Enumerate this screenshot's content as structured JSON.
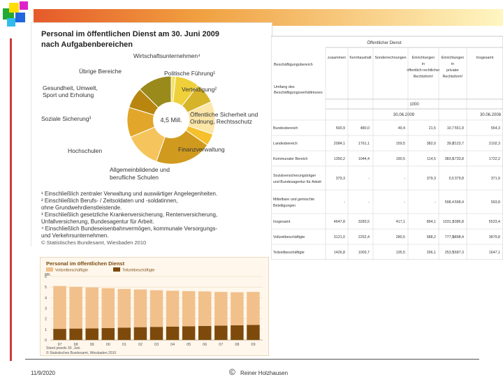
{
  "pie_chart": {
    "title_line1": "Personal im öffentlichen Dienst am 30. Juni 2009",
    "title_line2": "nach Aufgabenbereichen",
    "center_label": "4,5 Mill.",
    "labels": {
      "wirtschaft": "Wirtschaftsunternehmen⁴",
      "uebrige": "Übrige Bereiche",
      "politik": "Politische Führung¹",
      "gesundheit_1": "Gesundheit, Umwelt,",
      "gesundheit_2": "Sport und Erholung",
      "verteidigung": "Verteidigung²",
      "oeffsich_1": "Öffentliche Sicherheit und",
      "oeffsich_2": "Ordnung, Rechtsschutz",
      "sozial": "Soziale Sicherung³",
      "finanz": "Finanzverwaltung",
      "hochschulen": "Hochschulen",
      "allgemein_1": "Allgemeinbildende und",
      "allgemein_2": "berufliche Schulen"
    },
    "footnotes": [
      "¹ Einschließlich zentraler Verwaltung und auswärtiger Angelegenheiten.",
      "² Einschließlich Berufs- / Zeitsoldaten und -soldatinnen,",
      "   ohne Grundwehrdienstleistende.",
      "³ Einschließlich gesetzliche Krankenversicherung, Rentenversicherung,",
      "   Unfallversicherung, Bundesagentur für Arbeit.",
      "⁴ Einschließlich Bundeseisenbahnvermögen, kommunale Versorgungs-",
      "   und Verkehrsunternehmen."
    ],
    "source": "© Statistisches Bundesamt, Wiesbaden 2010"
  },
  "table": {
    "group_header": "Öffentlicher Dienst",
    "row_header_1": "Beschäftigungsbereich",
    "row_header_2": "Umfang des",
    "row_header_3": "Beschäftigungsverhältnisses",
    "columns": [
      "zusammen",
      "Kernhaushalt",
      "Sonderrechnungen",
      "Einrichtungen in öffentlich-rechtlicher Rechtsform¹",
      "Einrichtungen in privater Rechtsform²",
      "Insgesamt"
    ],
    "unit": "1000",
    "date_left": "30.06.2009",
    "date_right": "30.06.2008",
    "rows": [
      {
        "label": "Bundesbereich",
        "values": [
          "500,9",
          "480,0",
          "49,4",
          "21,5",
          "10,7",
          "551,9",
          "554,3"
        ]
      },
      {
        "label": "Landesbereich",
        "values": [
          "2084,1",
          "1761,1",
          "159,5",
          "382,0",
          "39,0",
          "2123,7",
          "2102,3"
        ]
      },
      {
        "label": "Kommunaler Bereich",
        "values": [
          "1350,2",
          "1044,4",
          "190,5",
          "114,5",
          "383,6",
          "1733,8",
          "1722,2"
        ]
      },
      {
        "label": "Sozialversicherungsträger und Bundesagentur für Arbeit",
        "values": [
          "379,3",
          "-",
          "-",
          "379,3",
          "0,5",
          "379,8",
          "371,9"
        ]
      },
      {
        "label": "Mittelbare und gemischte Beteiligungen",
        "values": [
          "-",
          "-",
          "-",
          "-",
          "598,4",
          "598,4",
          "593,8"
        ]
      },
      {
        "label": "Insgesamt",
        "values": [
          "4647,8",
          "3283,5",
          "417,1",
          "894,1",
          "1031,1",
          "5386,8",
          "5523,4"
        ]
      },
      {
        "label": "Vollzeitbeschäftigte",
        "values": [
          "3121,0",
          "2252,4",
          "280,5",
          "588,2",
          "777,5",
          "3898,4",
          "3879,8"
        ]
      },
      {
        "label": "Teilzeitbeschäftigte",
        "values": [
          "1426,8",
          "1003,7",
          "135,5",
          "296,1",
          "253,5",
          "1687,3",
          "1647,1"
        ]
      }
    ]
  },
  "bar_panel": {
    "source": "© Statistisches Bundesamt, Wiesbaden 2010",
    "note": "Stand jeweils 30. Juni."
  },
  "chart_data": [
    {
      "type": "pie",
      "title": "Personal im öffentlichen Dienst am 30. Juni 2009 nach Aufgabenbereichen",
      "total_label": "4,5 Mill.",
      "slices": [
        {
          "label": "Wirtschaftsunternehmen",
          "value": 1.5,
          "color": "#f3e26a"
        },
        {
          "label": "Politische Führung",
          "value": 8,
          "color": "#f0d03a"
        },
        {
          "label": "Verteidigung",
          "value": 7,
          "color": "#d6b42a"
        },
        {
          "label": "Öffentliche Sicherheit und Ordnung, Rechtsschutz",
          "value": 11,
          "color": "#fce6a8"
        },
        {
          "label": "Finanzverwaltung",
          "value": 4,
          "color": "#f5c02c"
        },
        {
          "label": "Allgemeinbildende und berufliche Schulen",
          "value": 19,
          "color": "#d09a1e"
        },
        {
          "label": "Hochschulen",
          "value": 12,
          "color": "#f6c45c"
        },
        {
          "label": "Soziale Sicherung",
          "value": 10,
          "color": "#e1a62a"
        },
        {
          "label": "Gesundheit, Umwelt, Sport und Erholung",
          "value": 7,
          "color": "#b8860f"
        },
        {
          "label": "Übrige Bereiche",
          "value": 11.5,
          "color": "#9a8a1c"
        }
      ]
    },
    {
      "type": "bar",
      "stacked": true,
      "title": "Personal im öffentlichen Dienst",
      "ylabel": "Mill.",
      "ylim": [
        0,
        6
      ],
      "yticks": [
        0,
        1,
        2,
        3,
        4,
        5,
        6
      ],
      "categories": [
        "97",
        "98",
        "99",
        "00",
        "01",
        "02",
        "03",
        "04",
        "05",
        "06",
        "07",
        "08",
        "09"
      ],
      "series": [
        {
          "name": "Teilzeitbeschäftigte",
          "color": "#7d4a0c",
          "values": [
            1.05,
            1.08,
            1.1,
            1.13,
            1.17,
            1.21,
            1.24,
            1.27,
            1.3,
            1.33,
            1.36,
            1.39,
            1.42
          ]
        },
        {
          "name": "Vollzeitbeschäftigte",
          "color": "#f2c08a",
          "values": [
            4.05,
            3.95,
            3.86,
            3.76,
            3.65,
            3.56,
            3.46,
            3.38,
            3.31,
            3.26,
            3.18,
            3.12,
            3.12
          ]
        }
      ]
    }
  ],
  "footer": {
    "date": "11/9/2020",
    "copyright_symbol": "©",
    "author": "Reiner Holzhausen"
  }
}
